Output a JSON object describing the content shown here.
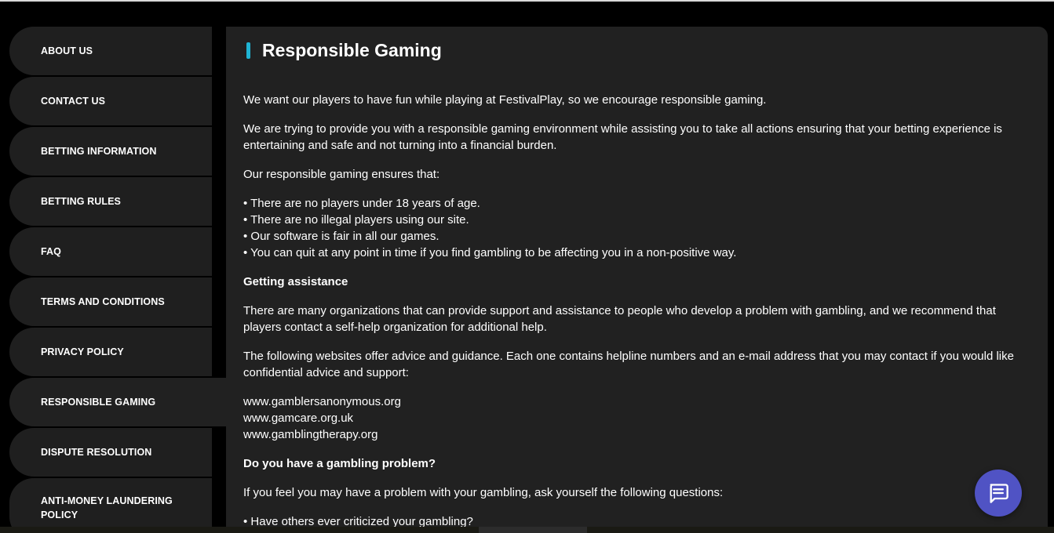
{
  "sidebar": {
    "items": [
      {
        "label": "ABOUT US"
      },
      {
        "label": "CONTACT US"
      },
      {
        "label": "BETTING INFORMATION"
      },
      {
        "label": "BETTING RULES"
      },
      {
        "label": "FAQ"
      },
      {
        "label": "TERMS AND CONDITIONS"
      },
      {
        "label": "PRIVACY POLICY"
      },
      {
        "label": "RESPONSIBLE GAMING",
        "active": true
      },
      {
        "label": "DISPUTE RESOLUTION"
      },
      {
        "label": "ANTI-MONEY LAUNDERING POLICY"
      }
    ]
  },
  "content": {
    "title": "Responsible Gaming",
    "p1": "We want our players to have fun while playing at FestivalPlay, so we encourage responsible gaming.",
    "p2": "We are trying to provide you with a responsible gaming environment while assisting you to take all actions ensuring that your betting experience is entertaining and safe and not turning into a financial burden.",
    "p3": "Our responsible gaming ensures that:",
    "bullets": [
      "• There are no players under 18 years of age.",
      "• There are no illegal players using our site.",
      "• Our software is fair in all our games.",
      "• You can quit at any point in time if you find gambling to be affecting you in a non-positive way."
    ],
    "heading_assistance": "Getting assistance",
    "p4": "There are many organizations that can provide support and assistance to people who develop a problem with gambling, and we recommend that players contact a self-help organization for additional help.",
    "p5": "The following websites offer advice and guidance. Each one contains helpline numbers and an e-mail address that you may contact if you would like confidential advice and support:",
    "websites": [
      "www.gamblersanonymous.org",
      "www.gamcare.org.uk",
      "www.gamblingtherapy.org"
    ],
    "heading_problem": "Do you have a gambling problem?",
    "p6": "If you feel you may have a problem with your gambling, ask yourself the following questions:",
    "q1": "• Have others ever criticized your gambling?"
  },
  "chat": {
    "icon": "chat-bubble-icon"
  },
  "colors": {
    "accent": "#1fb4d4",
    "panel": "#212121",
    "nav": "#1f1f1f",
    "chat": "#5053c4"
  }
}
